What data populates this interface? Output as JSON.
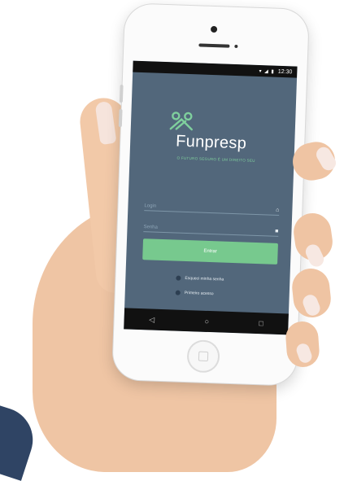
{
  "status_bar": {
    "icons": [
      "wifi-icon",
      "signal-icon",
      "battery-icon"
    ],
    "time": "12:30"
  },
  "app": {
    "brand": "Funpresp",
    "tagline": "O FUTURO SEGURO É UM DIREITO SEU",
    "login_placeholder": "Login",
    "password_placeholder": "Senha",
    "submit_label": "Entrar",
    "forgot_password": "Esqueci minha senha",
    "first_access": "Primeiro acesso"
  },
  "nav": {
    "back": "◁",
    "home": "○",
    "recents": "□"
  },
  "colors": {
    "screen_bg": "#52677b",
    "accent_green": "#77c98e",
    "status_bar_bg": "#111111"
  }
}
